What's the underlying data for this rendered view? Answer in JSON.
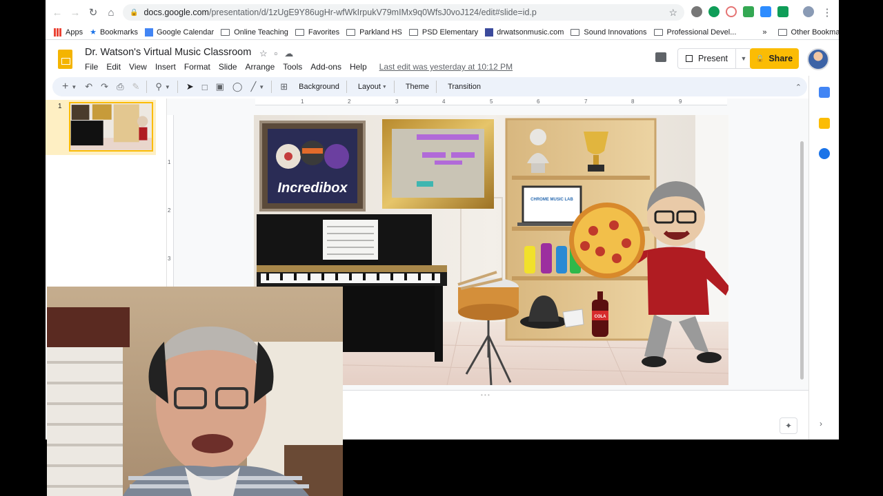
{
  "browser": {
    "url_host": "docs.google.com",
    "url_path": "/presentation/d/1zUgE9Y86ugHr-wfWkIrpukV79mIMx9q0WfsJ0voJ124/edit#slide=id.p",
    "bookmarks": [
      "Apps",
      "Bookmarks",
      "Google Calendar",
      "Online Teaching",
      "Favorites",
      "Parkland HS",
      "PSD Elementary",
      "drwatsonmusic.com",
      "Sound Innovations",
      "Professional Devel...",
      "»",
      "Other Bookmarks"
    ]
  },
  "doc": {
    "title": "Dr. Watson's Virtual Music Classroom",
    "menus": [
      "File",
      "Edit",
      "View",
      "Insert",
      "Format",
      "Slide",
      "Arrange",
      "Tools",
      "Add-ons",
      "Help"
    ],
    "last_edit": "Last edit was yesterday at 10:12 PM",
    "present_label": "Present",
    "share_label": "Share"
  },
  "toolbar": {
    "background": "Background",
    "layout": "Layout",
    "theme": "Theme",
    "transition": "Transition"
  },
  "ruler": {
    "top_ticks": [
      "1",
      "2",
      "3",
      "4",
      "5",
      "6",
      "7",
      "8",
      "9"
    ],
    "left_ticks": [
      "1",
      "2",
      "3"
    ]
  },
  "filmstrip": {
    "slide_number": "1"
  },
  "slide": {
    "incredibox_label": "Incredibox",
    "chrome_lab_label": "CHROME MUSIC LAB",
    "cola_label": "COLA"
  },
  "colors": {
    "share": "#fbbc04",
    "slides_logo": "#f4b400",
    "selected_slide": "#feefc3"
  }
}
